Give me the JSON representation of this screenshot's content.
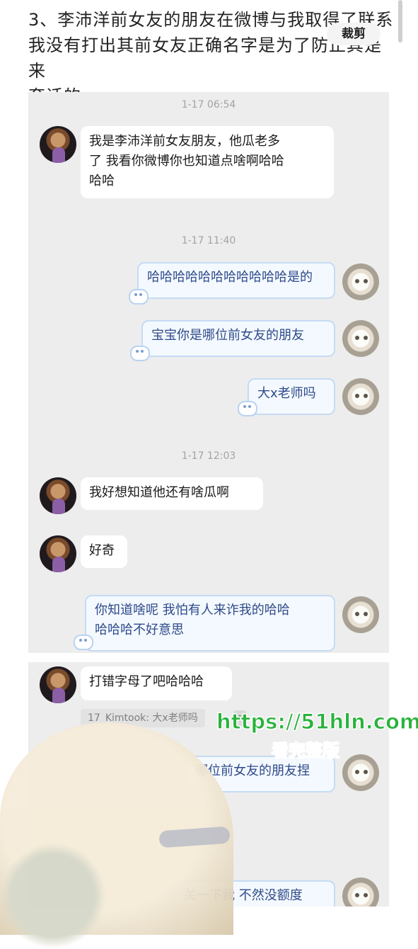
{
  "intro": {
    "line1": "3、李沛洋前女友的朋友在微博与我取得了联系",
    "line2": "我没有打出其前女友正确名字是为了防止其是来",
    "line3": "套话的。"
  },
  "crop_label": "裁剪",
  "chat": {
    "timestamps": [
      "1-17 06:54",
      "1-17 11:40",
      "1-17 12:03"
    ],
    "messages": [
      {
        "side": "left",
        "text_lines": [
          "我是李沛洋前女友朋友，他瓜老多",
          "了 我看你微博你也知道点啥啊哈哈",
          "哈哈"
        ]
      },
      {
        "side": "right",
        "text": "哈哈哈哈哈哈哈哈哈哈哈是的"
      },
      {
        "side": "right",
        "text": "宝宝你是哪位前女友的朋友"
      },
      {
        "side": "right",
        "text": "大x老师吗"
      },
      {
        "side": "left",
        "text": "我好想知道他还有啥瓜啊"
      },
      {
        "side": "left",
        "text": "好奇"
      },
      {
        "side": "right",
        "text_lines": [
          "你知道啥呢 我怕有人来诈我的哈哈",
          "哈哈哈不好意思"
        ]
      }
    ],
    "messages2": [
      {
        "side": "left",
        "text": "打错字母了吧哈哈哈"
      },
      {
        "quote": "17_Kimtook: 大x老师吗"
      },
      {
        "side": "right",
        "text": "哪位前女友的朋友捏"
      },
      {
        "side": "right",
        "text": "关一下我 不然没额度"
      }
    ]
  },
  "watermark": {
    "url": "https://51hln.com",
    "subtitle": "看完整版"
  }
}
